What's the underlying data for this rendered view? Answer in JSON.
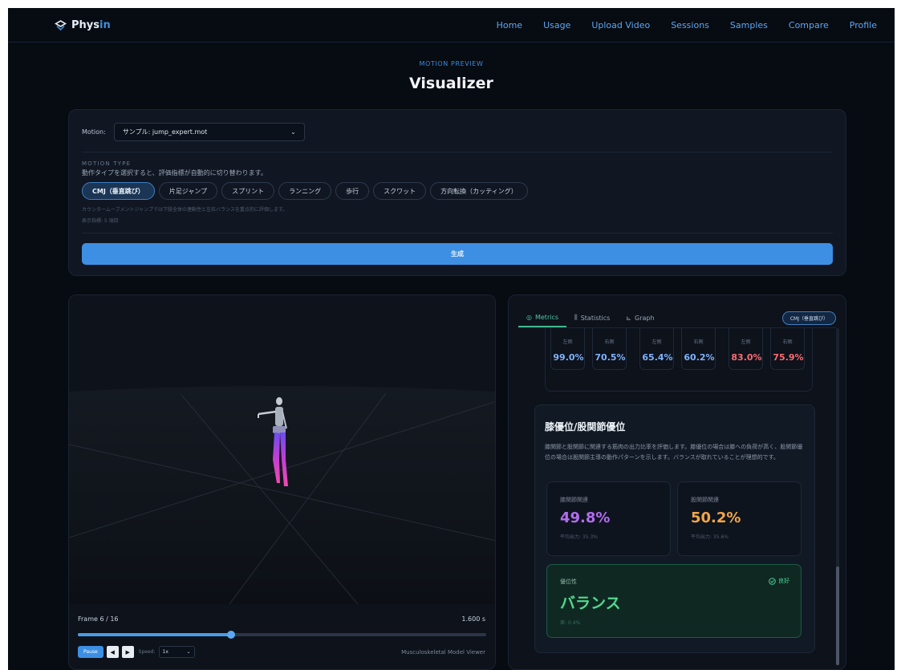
{
  "app": {
    "logo_prefix": "Phys",
    "logo_suffix": "in"
  },
  "nav": [
    "Home",
    "Usage",
    "Upload Video",
    "Sessions",
    "Samples",
    "Compare",
    "Profile"
  ],
  "header": {
    "kicker": "MOTION PREVIEW",
    "title": "Visualizer"
  },
  "controls": {
    "motion_label": "Motion:",
    "motion_value": "サンプル: jump_expert.mot",
    "type_label": "MOTION TYPE",
    "type_desc": "動作タイプを選択すると、評価指標が自動的に切り替わります。",
    "chips": [
      "CMJ（垂直跳び）",
      "片足ジャンプ",
      "スプリント",
      "ランニング",
      "歩行",
      "スクワット",
      "方向転換（カッティング）"
    ],
    "active_chip": 0,
    "note": "カウンタームーブメントジャンプでは下肢全体の連動性と左右バランスを重点的に評価します。",
    "count_note": "表示指標: 5 項目",
    "generate_label": "生成"
  },
  "viewer": {
    "frame_label": "Frame 6 / 16",
    "time_label": "1.600 s",
    "progress": 0.375,
    "pause_label": "Pause",
    "prev_icon": "◀",
    "next_icon": "▶",
    "speed_label": "Speed:",
    "speed_value": "1x",
    "viewer_name": "Musculoskeletal Model Viewer"
  },
  "panel": {
    "tabs": [
      {
        "label": "Metrics",
        "icon": "◎",
        "active": true
      },
      {
        "label": "Statistics",
        "icon": "⫼",
        "active": false
      },
      {
        "label": "Graph",
        "icon": "⊾",
        "active": false
      }
    ],
    "tag": "CMJ（垂直跳び）",
    "symmetry": [
      {
        "side": "左側",
        "value": "99.0%",
        "color": "#7fb2ff"
      },
      {
        "side": "右側",
        "value": "70.5%",
        "color": "#7fb2ff"
      },
      {
        "side": "左側",
        "value": "65.4%",
        "color": "#7fb2ff"
      },
      {
        "side": "右側",
        "value": "60.2%",
        "color": "#7fb2ff"
      },
      {
        "side": "左側",
        "value": "83.0%",
        "color": "#ff6b72"
      },
      {
        "side": "右側",
        "value": "75.9%",
        "color": "#ff6b72"
      }
    ],
    "knee": {
      "title": "膝優位/股関節優位",
      "desc": "膝関節と股関節に関連する筋肉の出力比率を評価します。膝優位の場合は膝への負荷が高く、股関節優位の場合は股関節主導の動作パターンを示します。バランスが取れていることが理想的です。",
      "knee_label": "膝関節関連",
      "knee_value": "49.8%",
      "knee_sub": "平均出力: 35.3%",
      "hip_label": "股関節関連",
      "hip_value": "50.2%",
      "hip_sub": "平均出力: 35.6%",
      "result_label": "優位性",
      "result_status": "良好",
      "result_value": "バランス",
      "result_sub": "差: 0.4%"
    }
  },
  "colors": {
    "accent": "#3d8fe4",
    "knee": "#b36cf0",
    "hip": "#f0a64a",
    "good": "#52d88f"
  }
}
